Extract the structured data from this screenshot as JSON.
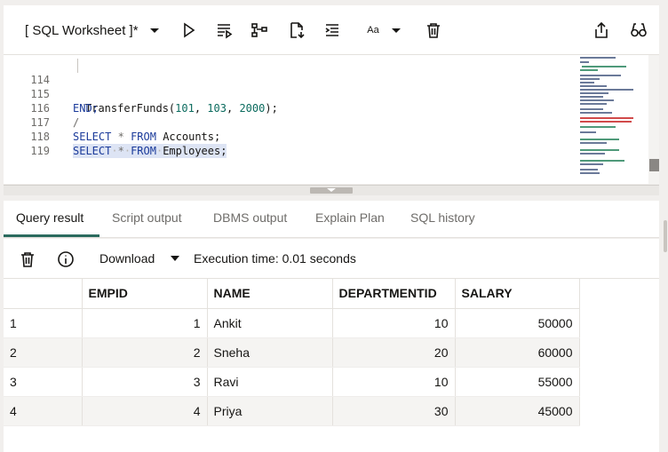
{
  "toolbar": {
    "worksheet_title": "[ SQL Worksheet ]*",
    "font_label": "Aa"
  },
  "editor": {
    "lines": [
      {
        "num": "114",
        "text": "TransferFunds(101, 103, 2000);"
      },
      {
        "num": "115",
        "text": "END;"
      },
      {
        "num": "116",
        "text": "/"
      },
      {
        "num": "117",
        "text": "SELECT * FROM Accounts;"
      },
      {
        "num": "118",
        "text": "SELECT * FROM Employees;"
      },
      {
        "num": "119",
        "text": ""
      }
    ]
  },
  "tabs": [
    "Query result",
    "Script output",
    "DBMS output",
    "Explain Plan",
    "SQL history"
  ],
  "results": {
    "download_label": "Download",
    "execution_time": "Execution time: 0.01 seconds",
    "columns": [
      "EMPID",
      "NAME",
      "DEPARTMENTID",
      "SALARY"
    ],
    "rows": [
      {
        "row": "1",
        "empid": "1",
        "name": "Ankit",
        "dept": "10",
        "salary": "50000"
      },
      {
        "row": "2",
        "empid": "2",
        "name": "Sneha",
        "dept": "20",
        "salary": "60000"
      },
      {
        "row": "3",
        "empid": "3",
        "name": "Ravi",
        "dept": "10",
        "salary": "55000"
      },
      {
        "row": "4",
        "empid": "4",
        "name": "Priya",
        "dept": "30",
        "salary": "45000"
      }
    ]
  },
  "colors": {
    "keyword": "#1a3a9a",
    "number": "#0b6b5e",
    "active_tab_underline": "#2b6b5e"
  },
  "icons": [
    "chevron-down-icon",
    "run-icon",
    "run-script-icon",
    "explain-plan-icon",
    "autotrace-icon",
    "format-icon",
    "clear-icon",
    "share-icon",
    "glasses-icon",
    "trash-icon",
    "info-icon"
  ]
}
